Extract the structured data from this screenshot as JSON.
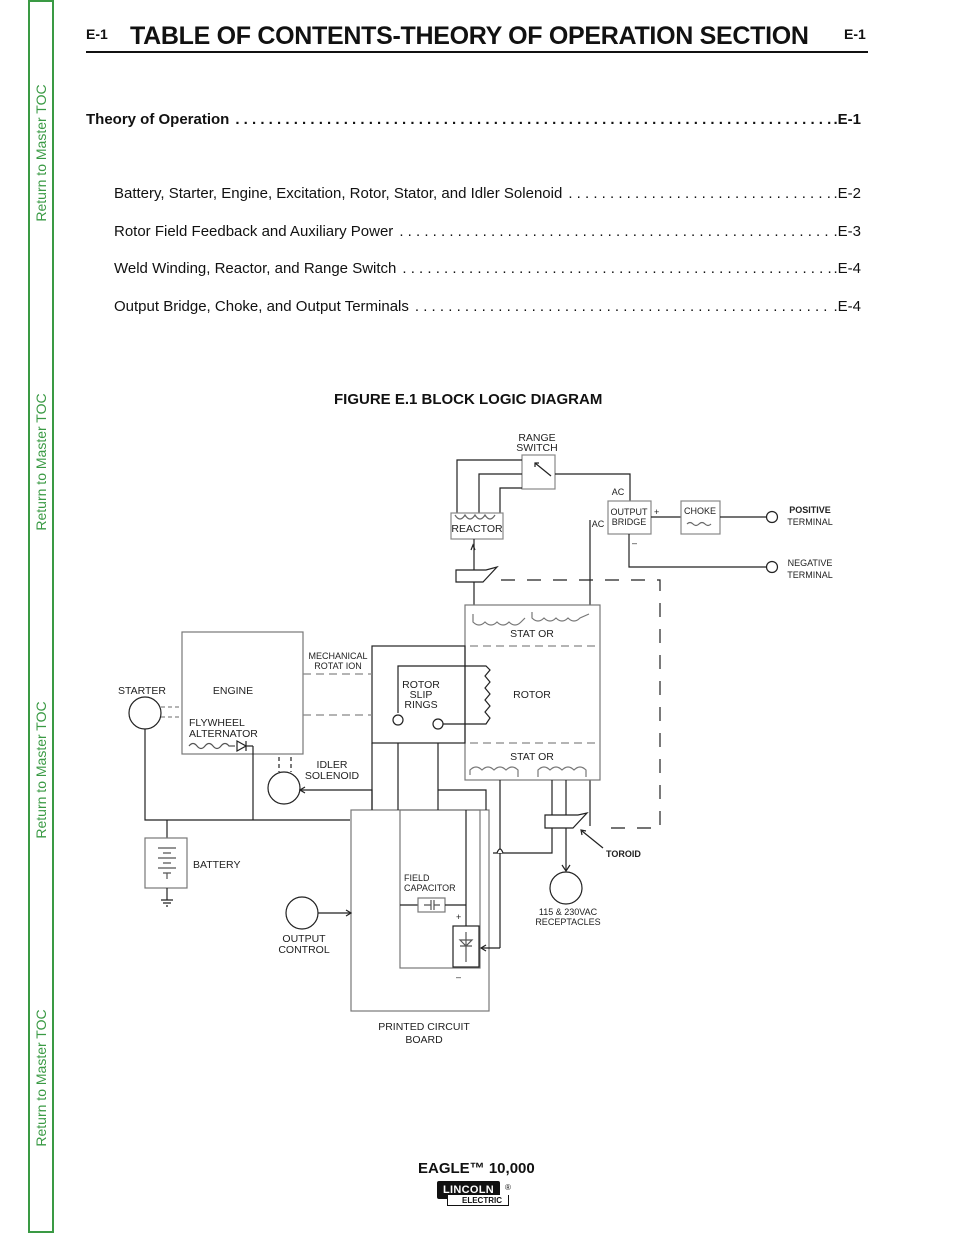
{
  "sidebar": {
    "links": [
      {
        "label": "Return to Master TOC"
      },
      {
        "label": "Return to Master TOC"
      },
      {
        "label": "Return to Master TOC"
      },
      {
        "label": "Return to Master TOC"
      }
    ]
  },
  "header": {
    "page_code_left": "E-1",
    "title": "TABLE OF CONTENTS-THEORY OF OPERATION SECTION",
    "page_code_right": "E-1"
  },
  "toc": {
    "main": {
      "label": "Theory of Operation",
      "page": ".E-1"
    },
    "entries": [
      {
        "label": "Battery, Starter, Engine, Excitation, Rotor, Stator, and Idler Solenoid",
        "page": ".E-2"
      },
      {
        "label": "Rotor Field Feedback and Auxiliary Power",
        "page": ".E-3"
      },
      {
        "label": "Weld Winding, Reactor, and Range Switch",
        "page": ".E-4"
      },
      {
        "label": "Output Bridge, Choke, and Output Terminals",
        "page": ".E-4"
      }
    ]
  },
  "figure": {
    "title": "FIGURE E.1  BLOCK LOGIC DIAGRAM",
    "labels": {
      "range_switch_1": "RANGE",
      "range_switch_2": "SWITCH",
      "reactor": "REACTOR",
      "ac_top": "AC",
      "ac_left": "AC",
      "output_bridge_1": "OUTPUT",
      "output_bridge_2": "BRIDGE",
      "plus": "+",
      "minus": "–",
      "choke": "CHOKE",
      "positive_1": "POSITIVE",
      "positive_2": "TERMINAL",
      "negative_1": "NEGATIVE",
      "negative_2": "TERMINAL",
      "stator_top": "STAT OR",
      "stator_bottom": "STAT OR",
      "rotor": "ROTOR",
      "rotor_slip_1": "ROTOR",
      "rotor_slip_2": "SLIP",
      "rotor_slip_3": "RINGS",
      "mech_1": "MECHANICAL",
      "mech_2": "ROTAT ION",
      "starter": "STARTER",
      "engine": "ENGINE",
      "flywheel_1": "FLYWHEEL",
      "flywheel_2": "ALTERNATOR",
      "idler_1": "IDLER",
      "idler_2": "SOLENOID",
      "battery": "BATTERY",
      "field_cap_1": "FIELD",
      "field_cap_2": "CAPACITOR",
      "output_control_1": "OUTPUT",
      "output_control_2": "CONTROL",
      "pcb_1": "PRINTED CIRCUIT",
      "pcb_2": "BOARD",
      "toroid": "TOROID",
      "receptacles_1": "115 & 230VAC",
      "receptacles_2": "RECEPTACLES",
      "bridge_plus": "+",
      "bridge_minus": "–"
    }
  },
  "footer": {
    "model": "EAGLE™ 10,000",
    "logo_top": "LINCOLN",
    "logo_bottom": "ELECTRIC",
    "logo_reg": "®"
  }
}
